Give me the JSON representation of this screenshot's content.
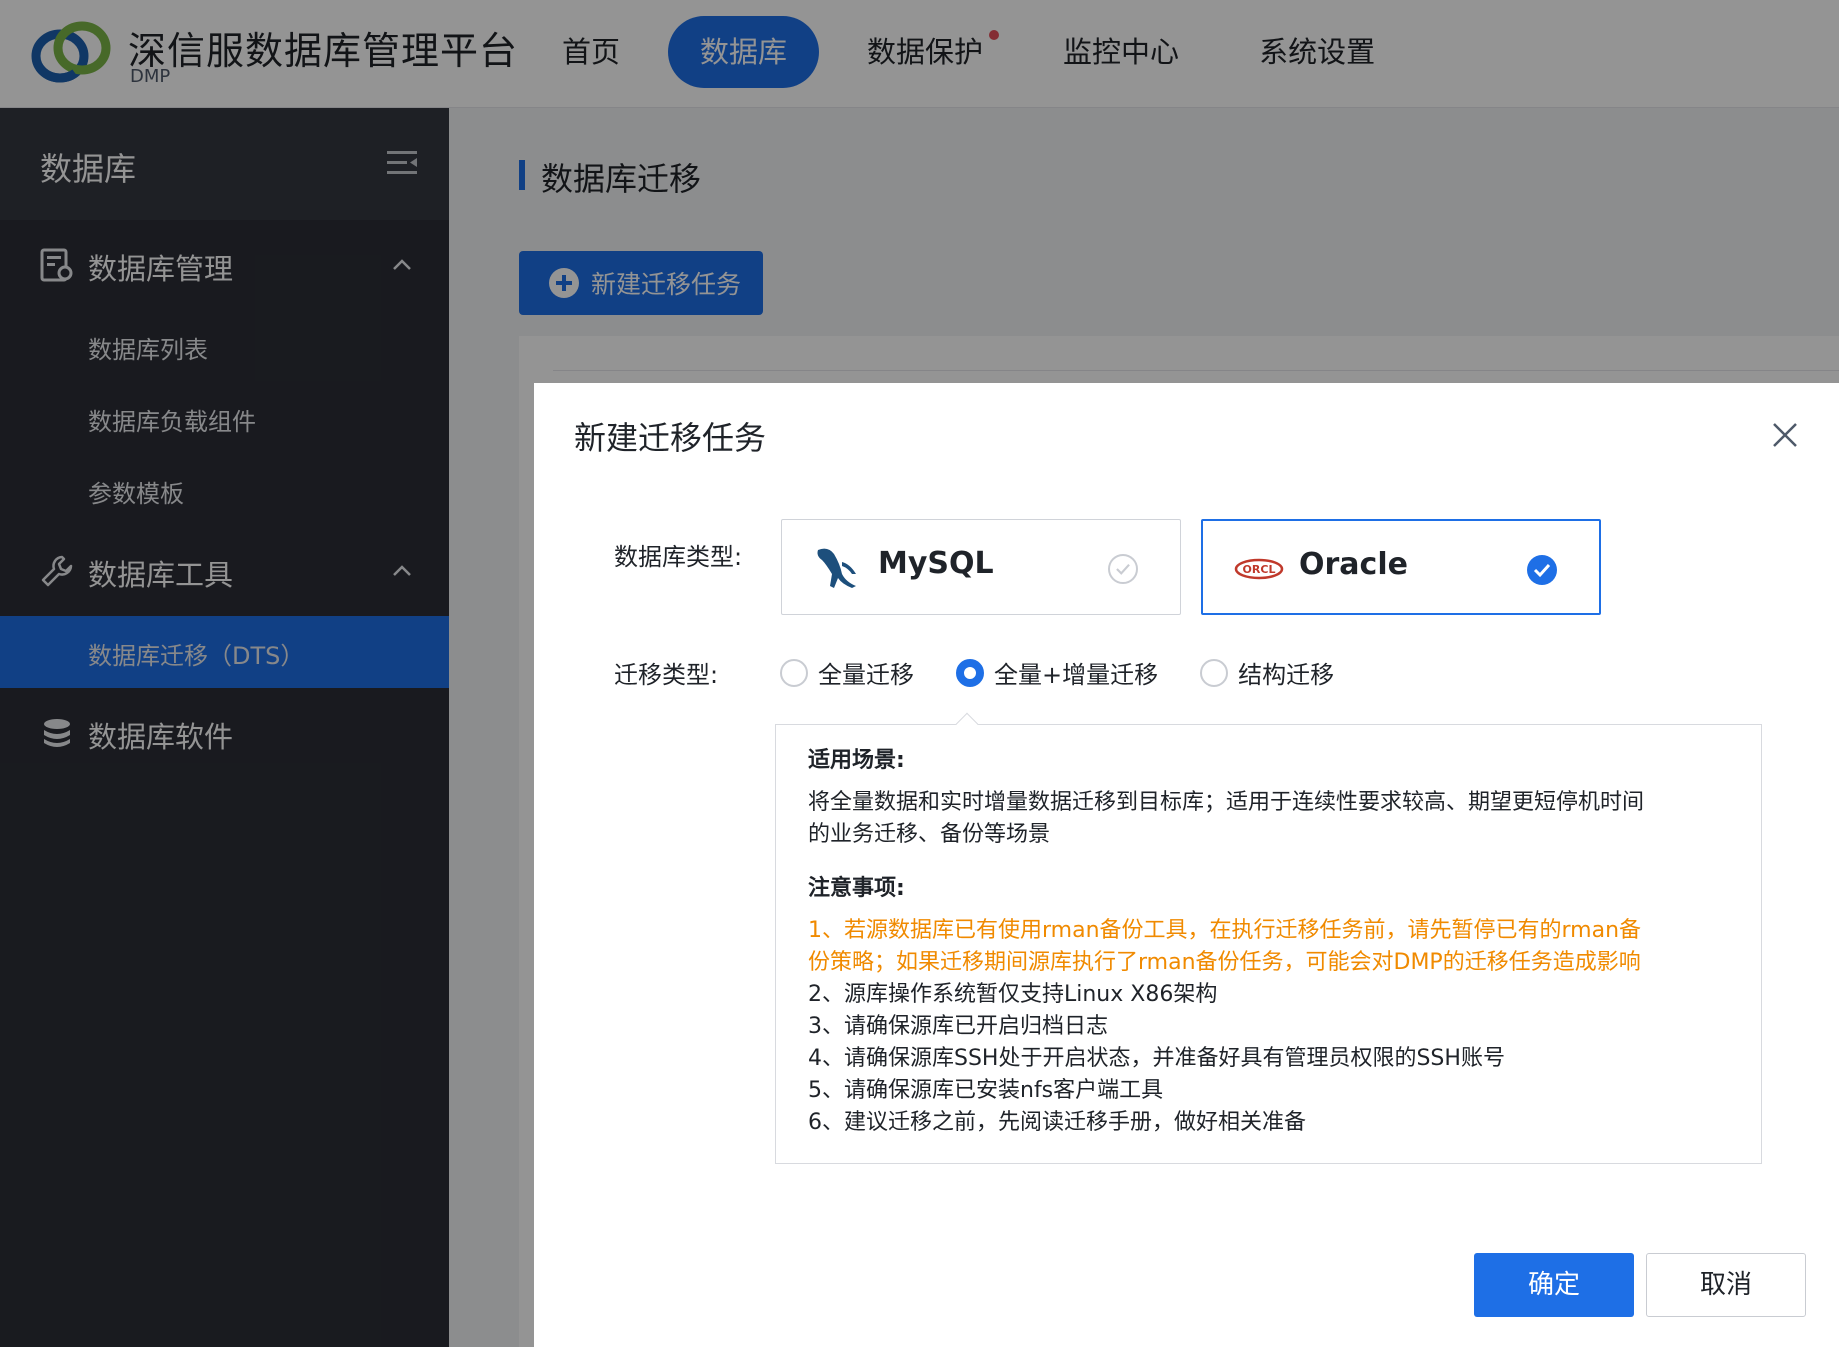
{
  "header": {
    "brand_title": "深信服数据库管理平台",
    "brand_sub": "DMP",
    "nav": [
      {
        "label": "首页"
      },
      {
        "label": "数据库"
      },
      {
        "label": "数据保护"
      },
      {
        "label": "监控中心"
      },
      {
        "label": "系统设置"
      }
    ],
    "active_nav": "数据库"
  },
  "sidebar": {
    "title": "数据库",
    "sections": [
      {
        "label": "数据库管理",
        "items": [
          "数据库列表",
          "数据库负载组件",
          "参数模板"
        ]
      },
      {
        "label": "数据库工具",
        "items": [
          "数据库迁移（DTS）"
        ]
      },
      {
        "label": "数据库软件",
        "items": []
      }
    ],
    "active_item": "数据库迁移（DTS）"
  },
  "main": {
    "page_title": "数据库迁移",
    "new_task_label": "新建迁移任务"
  },
  "modal": {
    "title": "新建迁移任务",
    "db_type_label": "数据库类型:",
    "db_options": [
      {
        "name": "MySQL",
        "selected": false
      },
      {
        "name": "Oracle",
        "selected": true
      }
    ],
    "migration_type_label": "迁移类型:",
    "migration_options": [
      {
        "label": "全量迁移",
        "checked": false
      },
      {
        "label": "全量+增量迁移",
        "checked": true
      },
      {
        "label": "结构迁移",
        "checked": false
      }
    ],
    "scenario_heading": "适用场景:",
    "scenario_text_1": "将全量数据和实时增量数据迁移到目标库；适用于连续性要求较高、期望更短停机时间",
    "scenario_text_2": "的业务迁移、备份等场景",
    "notes_heading": "注意事项:",
    "notes": [
      "1、若源数据库已有使用rman备份工具，在执行迁移任务前，请先暂停已有的rman备",
      "份策略；如果迁移期间源库执行了rman备份任务，可能会对DMP的迁移任务造成影响",
      "2、源库操作系统暂仅支持Linux X86架构",
      "3、请确保源库已开启归档日志",
      "4、请确保源库SSH处于开启状态，并准备好具有管理员权限的SSH账号",
      "5、请确保源库已安装nfs客户端工具",
      "6、建议迁移之前，先阅读迁移手册，做好相关准备"
    ],
    "ok_label": "确定",
    "cancel_label": "取消"
  },
  "colors": {
    "primary": "#1e6fe6",
    "warning": "#f08a00",
    "sidebar_bg": "#2b2e36"
  }
}
